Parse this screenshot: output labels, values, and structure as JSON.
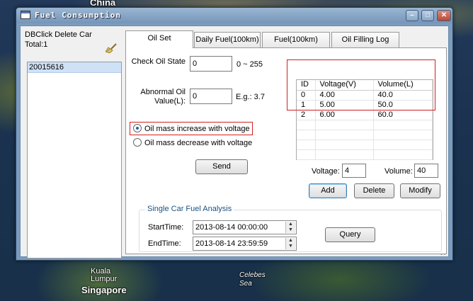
{
  "map": {
    "labels": [
      "China",
      "Kuala Lumpur",
      "Singapore",
      "Celebes Sea"
    ]
  },
  "window": {
    "title": "Fuel Consumption",
    "controls": {
      "minimize": "–",
      "maximize": "□",
      "close": "✕"
    }
  },
  "car_panel": {
    "hint": "DBClick Delete Car",
    "total": "Total:1",
    "clear_icon": "broom-icon",
    "cars": [
      "20015616"
    ]
  },
  "tabs": [
    {
      "label": "Oil Set",
      "active": true
    },
    {
      "label": "Daily Fuel(100km)",
      "active": false
    },
    {
      "label": "Fuel(100km)",
      "active": false
    },
    {
      "label": "Oil Filling Log",
      "active": false
    }
  ],
  "oil_set": {
    "check_oil_label": "Check Oil State",
    "check_oil_value": "0",
    "check_oil_range": "0 ~ 255",
    "abnormal_label": "Abnormal Oil Value(L):",
    "abnormal_value": "0",
    "abnormal_example": "E.g.: 3.7",
    "radio_increase": "Oil mass increase with voltage",
    "radio_decrease": "Oil mass decrease with voltage",
    "selected_mode": "increase",
    "send_label": "Send"
  },
  "calibration_table": {
    "columns": [
      "ID",
      "Voltage(V)",
      "Volume(L)"
    ],
    "rows": [
      [
        "0",
        "4.00",
        "40.0"
      ],
      [
        "1",
        "5.00",
        "50.0"
      ],
      [
        "2",
        "6.00",
        "60.0"
      ]
    ]
  },
  "editor": {
    "voltage_label": "Voltage:",
    "voltage_value": "4",
    "volume_label": "Volume:",
    "volume_value": "40",
    "add_label": "Add",
    "delete_label": "Delete",
    "modify_label": "Modify"
  },
  "analysis": {
    "group_title": "Single Car Fuel Analysis",
    "start_label": "StartTime:",
    "start_value": "2013-08-14 00:00:00",
    "end_label": "EndTime:",
    "end_value": "2013-08-14 23:59:59",
    "query_label": "Query"
  },
  "colors": {
    "highlight_box": "#d21f1f",
    "selection": "#cfe1f7",
    "group_title": "#1c5180"
  }
}
